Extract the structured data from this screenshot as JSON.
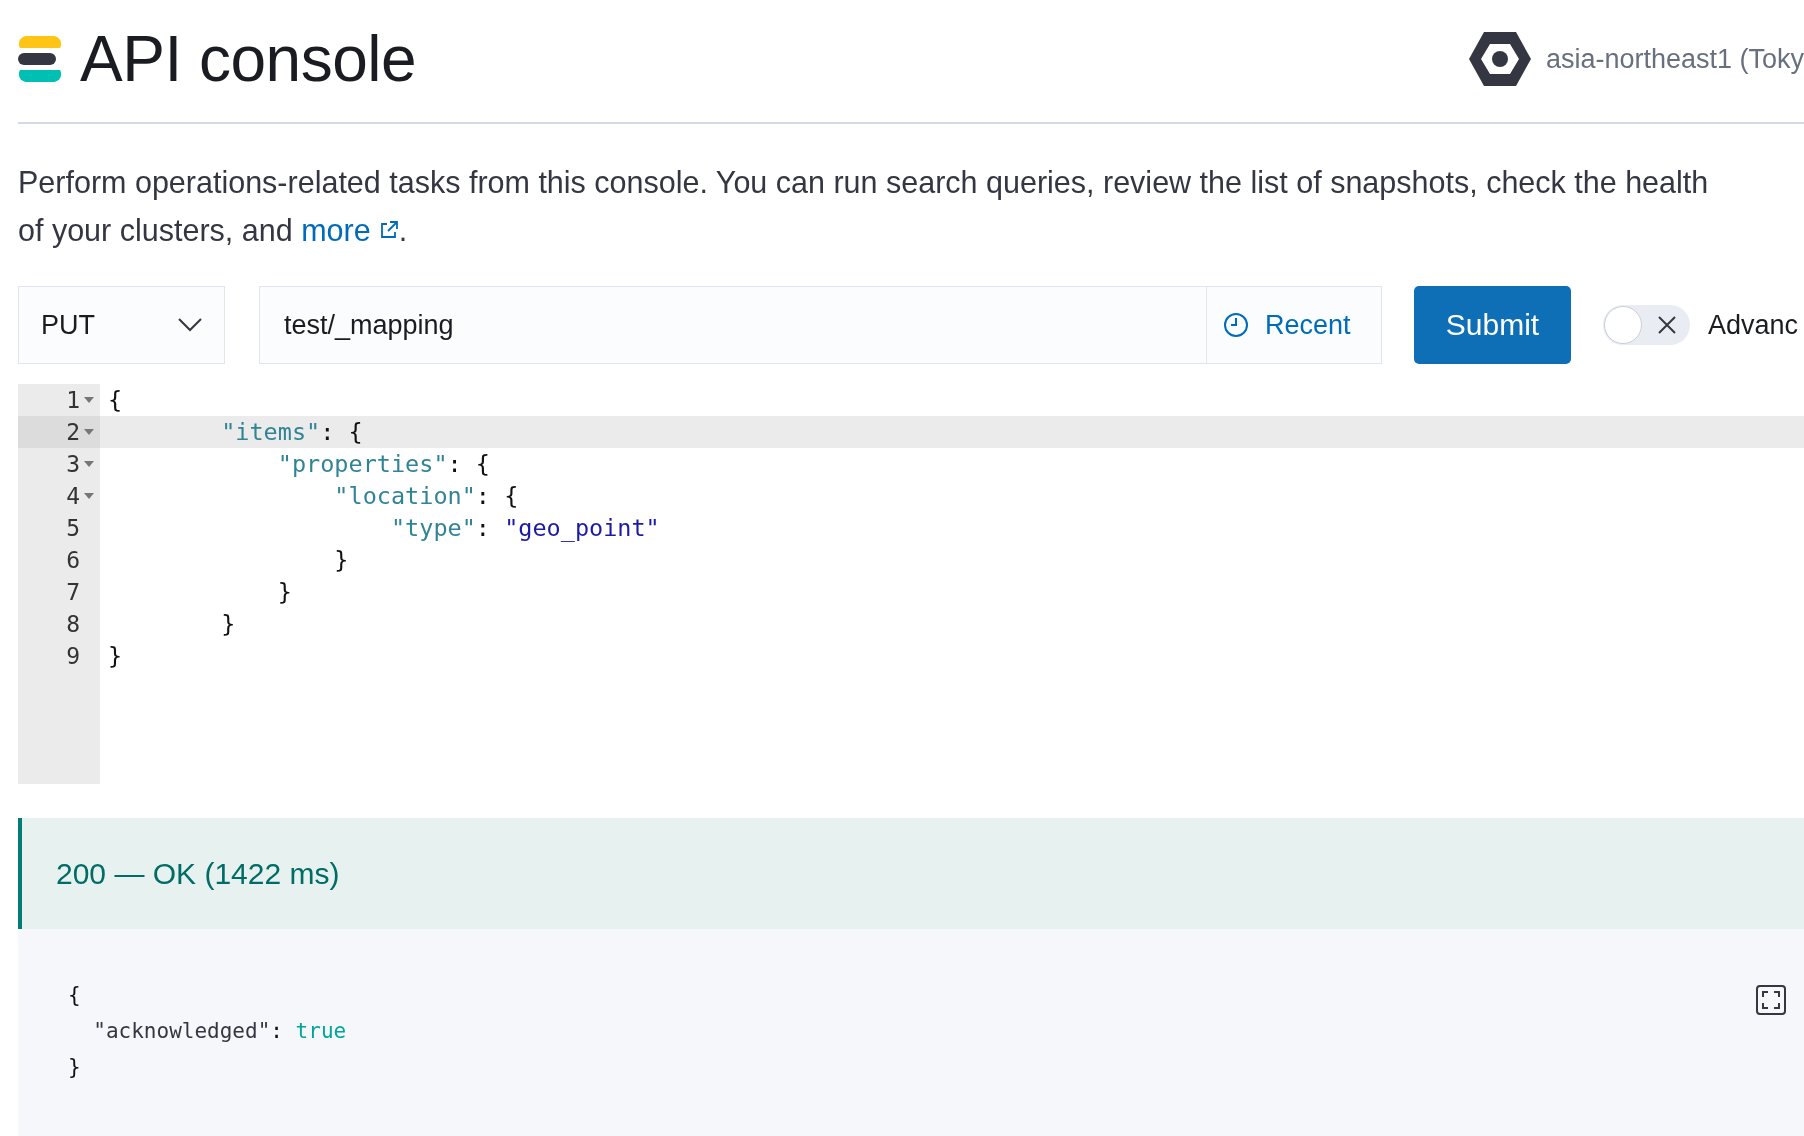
{
  "header": {
    "title": "API console",
    "region": "asia-northeast1 (Toky"
  },
  "description": {
    "text": "Perform operations-related tasks from this console. You can run search queries, review the list of snapshots, check the health of your clusters, and",
    "link": "more",
    "after": "."
  },
  "request": {
    "method": "PUT",
    "path": "test/_mapping",
    "recent": "Recent",
    "submit": "Submit",
    "toggle": {
      "label": "Advanc",
      "on": false
    }
  },
  "editor": {
    "lines": [
      {
        "number": "1",
        "fold": true,
        "active": false,
        "tokens": [
          {
            "kind": "punct",
            "text": "{"
          }
        ]
      },
      {
        "number": "2",
        "fold": true,
        "active": true,
        "tokens": [
          {
            "kind": "key",
            "text": "\"items\""
          },
          {
            "kind": "punct",
            "text": ": {"
          }
        ]
      },
      {
        "number": "3",
        "fold": true,
        "active": false,
        "tokens": [
          {
            "kind": "key",
            "text": "\"properties\""
          },
          {
            "kind": "punct",
            "text": ": {"
          }
        ]
      },
      {
        "number": "4",
        "fold": true,
        "active": false,
        "tokens": [
          {
            "kind": "key",
            "text": "\"location\""
          },
          {
            "kind": "punct",
            "text": ": {"
          }
        ]
      },
      {
        "number": "5",
        "fold": false,
        "active": false,
        "tokens": [
          {
            "kind": "key",
            "text": "\"type\""
          },
          {
            "kind": "punct",
            "text": ": "
          },
          {
            "kind": "string",
            "text": "\"geo_point\""
          }
        ]
      },
      {
        "number": "6",
        "fold": false,
        "active": false,
        "tokens": [
          {
            "kind": "punct",
            "text": "}"
          }
        ]
      },
      {
        "number": "7",
        "fold": false,
        "active": false,
        "tokens": [
          {
            "kind": "punct",
            "text": "}"
          }
        ]
      },
      {
        "number": "8",
        "fold": false,
        "active": false,
        "tokens": [
          {
            "kind": "punct",
            "text": "}"
          }
        ]
      },
      {
        "number": "9",
        "fold": false,
        "active": false,
        "tokens": [
          {
            "kind": "punct",
            "text": "}"
          }
        ]
      }
    ]
  },
  "response": {
    "status": "200 — OK (1422 ms)",
    "lines": [
      [
        {
          "kind": "punct",
          "text": "{"
        }
      ],
      [
        {
          "kind": "field",
          "text": "\"acknowledged\""
        },
        {
          "kind": "punct",
          "text": ": "
        },
        {
          "kind": "literal",
          "text": "true"
        }
      ],
      [
        {
          "kind": "punct",
          "text": "}"
        }
      ]
    ]
  }
}
